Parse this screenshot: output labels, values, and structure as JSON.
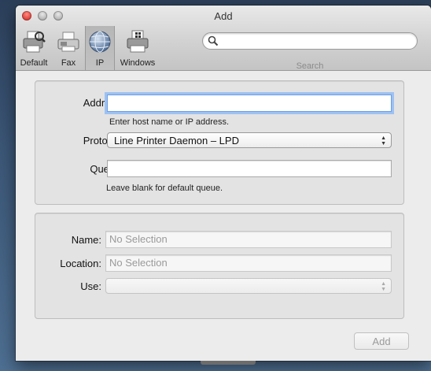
{
  "window": {
    "title": "Add"
  },
  "toolbar": {
    "items": [
      {
        "label": "Default",
        "icon": "printer-icon"
      },
      {
        "label": "Fax",
        "icon": "fax-icon"
      },
      {
        "label": "IP",
        "icon": "globe-icon",
        "selected": true
      },
      {
        "label": "Windows",
        "icon": "windows-printer-icon"
      }
    ],
    "search": {
      "value": "",
      "placeholder": "",
      "label": "Search"
    }
  },
  "connection": {
    "address_label": "Address:",
    "address_value": "",
    "address_hint": "Enter host name or IP address.",
    "protocol_label": "Protocol:",
    "protocol_value": "Line Printer Daemon – LPD",
    "queue_label": "Queue:",
    "queue_value": "",
    "queue_hint": "Leave blank for default queue."
  },
  "details": {
    "name_label": "Name:",
    "name_value": "No Selection",
    "location_label": "Location:",
    "location_value": "No Selection",
    "use_label": "Use:",
    "use_value": ""
  },
  "footer": {
    "add_label": "Add"
  },
  "colors": {
    "focus_ring": "#9dc2f2",
    "close_light": "#e0443e"
  }
}
